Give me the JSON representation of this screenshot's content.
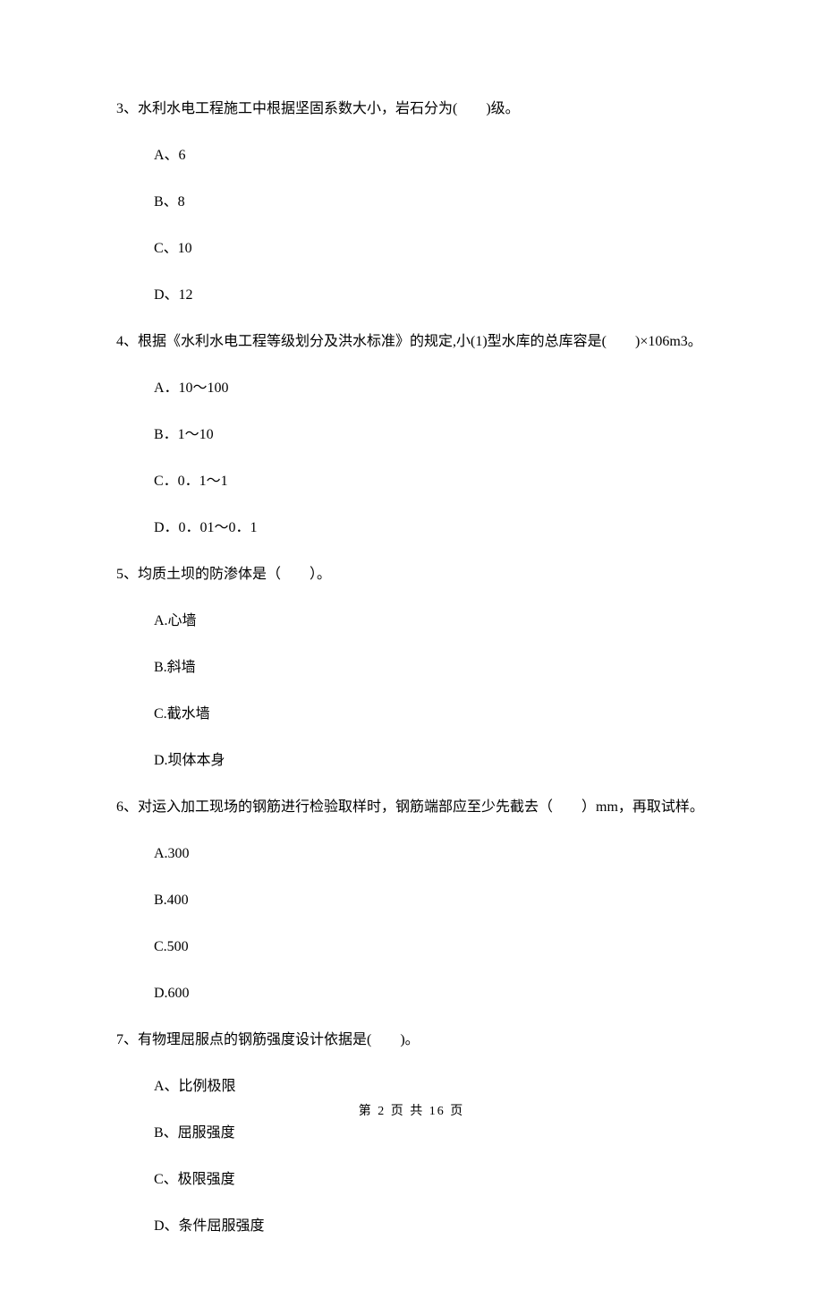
{
  "questions": [
    {
      "num": "3、",
      "text": "水利水电工程施工中根据坚固系数大小，岩石分为(　　)级。",
      "options": [
        "A、6",
        "B、8",
        "C、10",
        "D、12"
      ]
    },
    {
      "num": "4、",
      "text": "根据《水利水电工程等级划分及洪水标准》的规定,小(1)型水库的总库容是(　　)×106m3。",
      "options": [
        "A．10～100",
        "B．1～10",
        "C．0．1～1",
        "D．0．01～0．1"
      ]
    },
    {
      "num": "5、",
      "text": "均质土坝的防渗体是（　　）。",
      "options": [
        "A.心墙",
        "B.斜墙",
        "C.截水墙",
        "D.坝体本身"
      ]
    },
    {
      "num": "6、",
      "text": "对运入加工现场的钢筋进行检验取样时，钢筋端部应至少先截去（　　）mm，再取试样。",
      "options": [
        "A.300",
        "B.400",
        "C.500",
        "D.600"
      ]
    },
    {
      "num": "7、",
      "text": "有物理屈服点的钢筋强度设计依据是(　　)。",
      "options": [
        "A、比例极限",
        "B、屈服强度",
        "C、极限强度",
        "D、条件屈服强度"
      ]
    }
  ],
  "footer": "第 2 页 共 16 页"
}
